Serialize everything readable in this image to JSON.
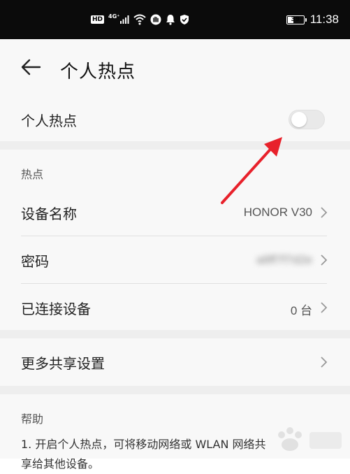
{
  "status_bar": {
    "hd_label": "HD",
    "network_label": "4G⁺",
    "battery_level": "39",
    "battery_fraction": 0.39,
    "time": "11:38"
  },
  "header": {
    "back_icon": "arrow-left-icon",
    "title": "个人热点"
  },
  "hotspot_toggle": {
    "label": "个人热点",
    "enabled": false
  },
  "hotspot_section": {
    "header": "热点",
    "rows": [
      {
        "label": "设备名称",
        "value": "HONOR V30"
      },
      {
        "label": "密码",
        "value": "a8ff7f7d2e"
      },
      {
        "label": "已连接设备",
        "value": "0 台"
      }
    ]
  },
  "more_sharing": {
    "label": "更多共享设置"
  },
  "help": {
    "header": "帮助",
    "line1": "1. 开启个人热点，可将移动网络或 WLAN 网络共",
    "line2": "享给其他设备。"
  },
  "colors": {
    "accent_arrow": "#e8212b",
    "page_bg": "#f8f8f8",
    "gap_bg": "#eeeeee"
  }
}
